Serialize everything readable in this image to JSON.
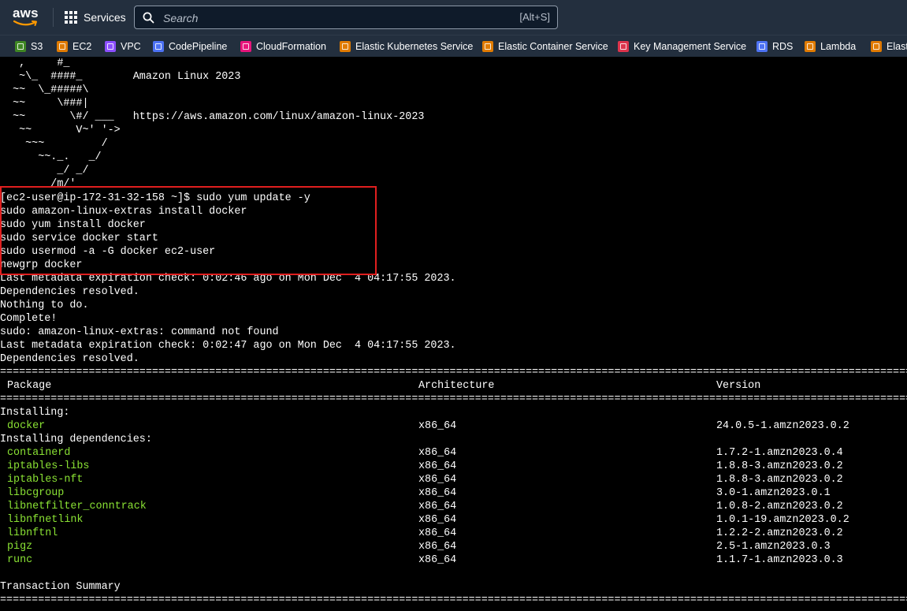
{
  "nav": {
    "logo_text": "aws",
    "services_label": "Services",
    "search_placeholder": "Search",
    "search_shortcut": "[Alt+S]"
  },
  "favorites": [
    {
      "label": "S3",
      "color": "#3f8624"
    },
    {
      "label": "EC2",
      "color": "#e07b00"
    },
    {
      "label": "VPC",
      "color": "#8c4fff"
    },
    {
      "label": "CodePipeline",
      "color": "#4d72f3"
    },
    {
      "label": "CloudFormation",
      "color": "#e7157b"
    },
    {
      "label": "Elastic Kubernetes Service",
      "color": "#e07b00"
    },
    {
      "label": "Elastic Container Service",
      "color": "#e07b00"
    },
    {
      "label": "Key Management Service",
      "color": "#dd344c"
    },
    {
      "label": "RDS",
      "color": "#4d72f3"
    },
    {
      "label": "Lambda",
      "color": "#e07b00"
    },
    {
      "label": "Elasti",
      "color": "#e07b00"
    }
  ],
  "terminal": {
    "highlight_color": "#e01f1f",
    "package_color": "#8ae234",
    "banner": [
      "   ,     #_",
      "   ~\\_  ####_        Amazon Linux 2023",
      "  ~~  \\_#####\\",
      "  ~~     \\###|",
      "  ~~       \\#/ ___   https://aws.amazon.com/linux/amazon-linux-2023",
      "   ~~       V~' '->",
      "    ~~~         /",
      "      ~~._.   _/",
      "         _/ _/",
      "       _/m/'"
    ],
    "commands": [
      "[ec2-user@ip-172-31-32-158 ~]$ sudo yum update -y",
      "sudo amazon-linux-extras install docker",
      "sudo yum install docker",
      "sudo service docker start",
      "sudo usermod -a -G docker ec2-user",
      "newgrp docker"
    ],
    "output": [
      "Last metadata expiration check: 0:02:46 ago on Mon Dec  4 04:17:55 2023.",
      "Dependencies resolved.",
      "Nothing to do.",
      "Complete!",
      "sudo: amazon-linux-extras: command not found",
      "Last metadata expiration check: 0:02:47 ago on Mon Dec  4 04:17:55 2023.",
      "Dependencies resolved."
    ],
    "separator_char": "=",
    "table": {
      "headers": {
        "package": "Package",
        "arch": "Architecture",
        "version": "Version"
      },
      "installing_label": "Installing:",
      "installing": [
        {
          "name": "docker",
          "arch": "x86_64",
          "version": "24.0.5-1.amzn2023.0.2"
        }
      ],
      "deps_label": "Installing dependencies:",
      "dependencies": [
        {
          "name": "containerd",
          "arch": "x86_64",
          "version": "1.7.2-1.amzn2023.0.4"
        },
        {
          "name": "iptables-libs",
          "arch": "x86_64",
          "version": "1.8.8-3.amzn2023.0.2"
        },
        {
          "name": "iptables-nft",
          "arch": "x86_64",
          "version": "1.8.8-3.amzn2023.0.2"
        },
        {
          "name": "libcgroup",
          "arch": "x86_64",
          "version": "3.0-1.amzn2023.0.1"
        },
        {
          "name": "libnetfilter_conntrack",
          "arch": "x86_64",
          "version": "1.0.8-2.amzn2023.0.2"
        },
        {
          "name": "libnfnetlink",
          "arch": "x86_64",
          "version": "1.0.1-19.amzn2023.0.2"
        },
        {
          "name": "libnftnl",
          "arch": "x86_64",
          "version": "1.2.2-2.amzn2023.0.2"
        },
        {
          "name": "pigz",
          "arch": "x86_64",
          "version": "2.5-1.amzn2023.0.3"
        },
        {
          "name": "runc",
          "arch": "x86_64",
          "version": "1.1.7-1.amzn2023.0.3"
        }
      ]
    },
    "summary_label": "Transaction Summary"
  }
}
